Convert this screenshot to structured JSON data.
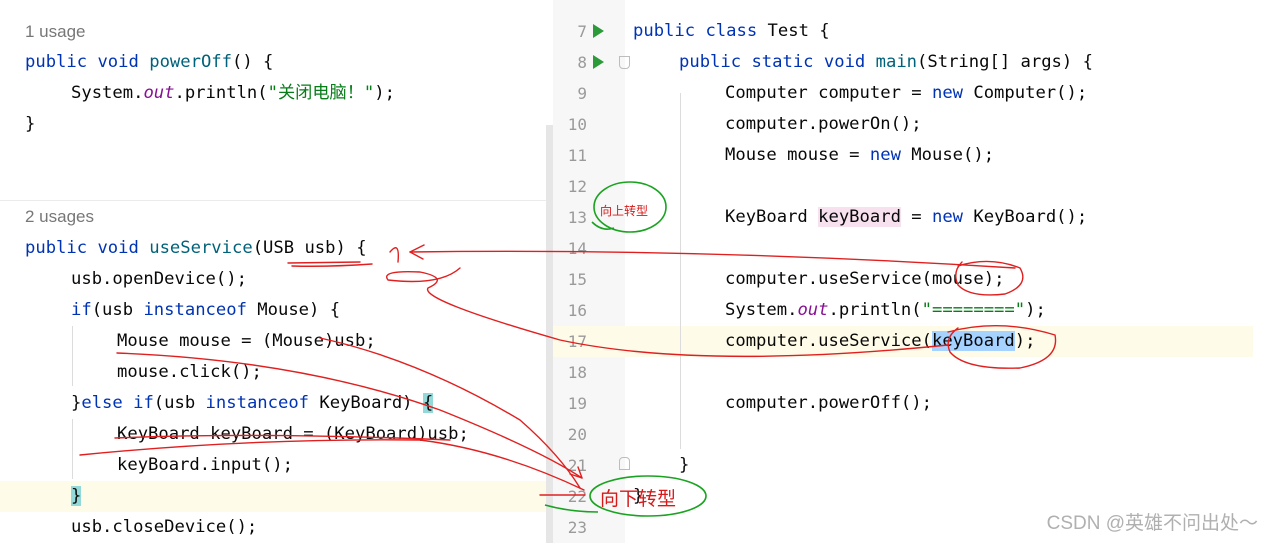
{
  "left": {
    "usage1": "1 usage",
    "usage2": "2 usages",
    "lines": {
      "a1": "public",
      "a2": "void",
      "a3": "powerOff",
      "a4": "() {",
      "b1": "System.",
      "b2": "out",
      "b3": ".println(",
      "b4": "\"关闭电脑！\"",
      "b5": ");",
      "c1": "}",
      "d1": "public",
      "d2": "void",
      "d3": "useService",
      "d4": "(USB usb) ",
      "d5": "{",
      "e1": "usb.openDevice();",
      "f1": "if",
      "f2": "(usb ",
      "f3": "instanceof",
      "f4": " Mouse) {",
      "g1": "Mouse mouse = (Mouse)usb;",
      "h1": "mouse.click();",
      "i1": "}",
      "i2": "else if",
      "i3": "(usb ",
      "i4": "instanceof",
      "i5": " KeyBoard) ",
      "i6": "{",
      "j1": "KeyBoard keyBoard = (KeyBoard)usb;",
      "k1": "keyBoard.input();",
      "l1": "}",
      "m1": "usb.closeDevice();"
    }
  },
  "right": {
    "line_numbers": [
      "7",
      "8",
      "9",
      "10",
      "11",
      "12",
      "13",
      "14",
      "15",
      "16",
      "17",
      "18",
      "19",
      "20",
      "21",
      "22",
      "23"
    ],
    "lines": {
      "r7a": "public",
      "r7b": " class",
      "r7c": " Test {",
      "r8a": "public",
      "r8b": " static",
      "r8c": " void",
      "r8d": " main",
      "r8e": "(String[] args) {",
      "r9a": "Computer computer = ",
      "r9b": "new",
      "r9c": " Computer();",
      "r10": "computer.powerOn();",
      "r11a": "Mouse mouse = ",
      "r11b": "new",
      "r11c": " Mouse();",
      "r13a": "KeyBoard ",
      "r13b": "keyBoard",
      "r13c": " = ",
      "r13d": "new",
      "r13e": " KeyBoard();",
      "r15a": "computer.useService(",
      "r15b": "mouse",
      "r15c": ");",
      "r16a": "System.",
      "r16b": "out",
      "r16c": ".println(",
      "r16d": "\"========\"",
      "r16e": ");",
      "r17a": "computer.useService(",
      "r17b": "keyBoard",
      "r17c": ");",
      "r19": "computer.powerOff();",
      "r21": "}",
      "r22": "}"
    }
  },
  "annotations": {
    "upcast": "向上转型",
    "downcast": "向下转型"
  },
  "watermark": "CSDN @英雄不问出处～",
  "colors": {
    "keyword": "#0033b3",
    "method": "#00627a",
    "string": "#067d17",
    "static_field": "#871094",
    "annotation": "#d61a1a"
  }
}
